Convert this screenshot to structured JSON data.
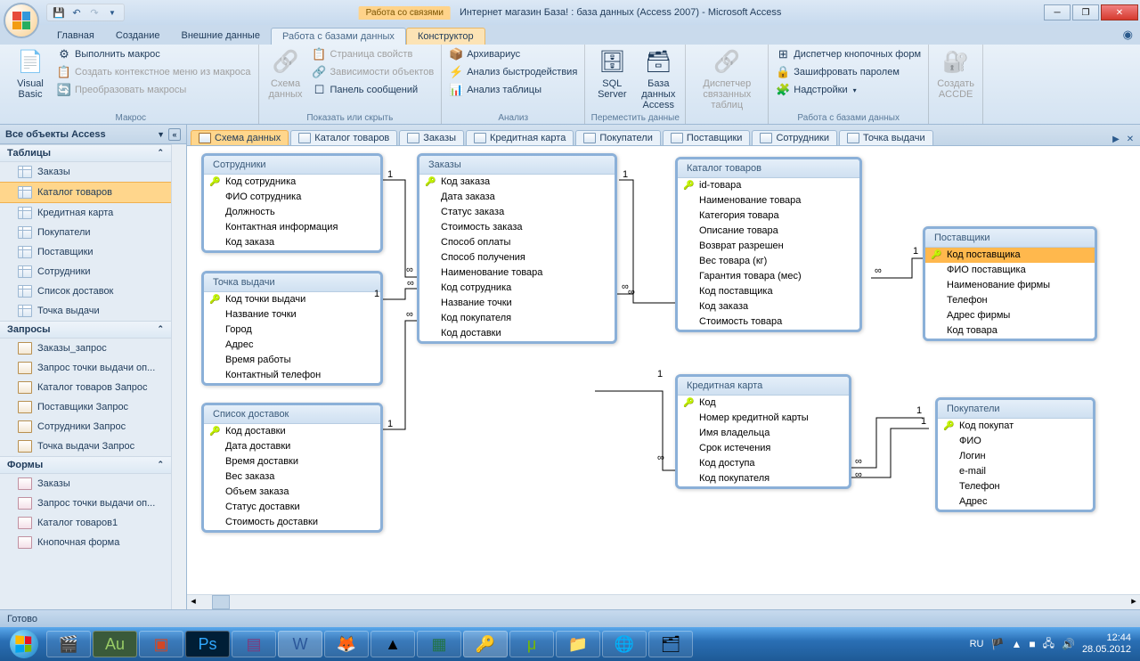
{
  "titlebar": {
    "context": "Работа со связями",
    "title": "Интернет магазин База! : база данных (Access 2007) - Microsoft Access"
  },
  "ribbon_tabs": [
    "Главная",
    "Создание",
    "Внешние данные",
    "Работа с базами данных",
    "Конструктор"
  ],
  "ribbon_tabs_active_index": 3,
  "ribbon": {
    "g1": {
      "label": "Макрос",
      "big": "Visual\nBasic",
      "items": [
        "Выполнить макрос",
        "Создать контекстное меню из макроса",
        "Преобразовать макросы"
      ]
    },
    "g2": {
      "label": "Показать или скрыть",
      "big": "Схема\nданных",
      "items": [
        "Страница свойств",
        "Зависимости объектов",
        "Панель сообщений"
      ]
    },
    "g3": {
      "label": "Анализ",
      "items": [
        "Архивариус",
        "Анализ быстродействия",
        "Анализ таблицы"
      ]
    },
    "g4": {
      "label": "Переместить данные",
      "b1": "SQL\nServer",
      "b2": "База данных\nAccess"
    },
    "g5": {
      "big": "Диспетчер\nсвязанных таблиц"
    },
    "g6": {
      "label": "Работа с базами данных",
      "items": [
        "Диспетчер кнопочных форм",
        "Зашифровать паролем",
        "Надстройки"
      ]
    },
    "g7": {
      "big": "Создать\nACCDE"
    }
  },
  "nav": {
    "header": "Все объекты Access",
    "g_tables": "Таблицы",
    "tables": [
      "Заказы",
      "Каталог товаров",
      "Кредитная карта",
      "Покупатели",
      "Поставщики",
      "Сотрудники",
      "Список доставок",
      "Точка выдачи"
    ],
    "tables_selected_index": 1,
    "g_queries": "Запросы",
    "queries": [
      "Заказы_запрос",
      "Запрос точки выдачи оп...",
      "Каталог товаров Запрос",
      "Поставщики Запрос",
      "Сотрудники Запрос",
      "Точка выдачи Запрос"
    ],
    "g_forms": "Формы",
    "forms": [
      "Заказы",
      "Запрос точки выдачи оп...",
      "Каталог товаров1",
      "Кнопочная форма"
    ]
  },
  "doc_tabs": [
    "Схема данных",
    "Каталог товаров",
    "Заказы",
    "Кредитная карта",
    "Покупатели",
    "Поставщики",
    "Сотрудники",
    "Точка выдачи"
  ],
  "doc_tabs_active_index": 0,
  "schema": {
    "t1": {
      "title": "Сотрудники",
      "rows": [
        "Код сотрудника",
        "ФИО сотрудника",
        "Должность",
        "Контактная информация",
        "Код заказа"
      ],
      "pk": [
        0
      ]
    },
    "t2": {
      "title": "Точка выдачи",
      "rows": [
        "Код точки выдачи",
        "Название точки",
        "Город",
        "Адрес",
        "Время работы",
        "Контактный телефон"
      ],
      "pk": [
        0
      ]
    },
    "t3": {
      "title": "Список доставок",
      "rows": [
        "Код доставки",
        "Дата доставки",
        "Время доставки",
        "Вес заказа",
        "Объем заказа",
        "Статус доставки",
        "Стоимость доставки"
      ],
      "pk": [
        0
      ]
    },
    "t4": {
      "title": "Заказы",
      "rows": [
        "Код заказа",
        "Дата заказа",
        "Статус заказа",
        "Стоимость заказа",
        "Способ оплаты",
        "Способ получения",
        "Наименование товара",
        "Код сотрудника",
        "Название точки",
        "Код покупателя",
        "Код доставки"
      ],
      "pk": [
        0
      ]
    },
    "t5": {
      "title": "Каталог товаров",
      "rows": [
        "id-товара",
        "Наименование товара",
        "Категория товара",
        "Описание товара",
        "Возврат разрешен",
        "Вес товара (кг)",
        "Гарантия товара (мес)",
        "Код поставщика",
        "Код заказа",
        "Стоимость товара"
      ],
      "pk": [
        0
      ]
    },
    "t6": {
      "title": "Кредитная карта",
      "rows": [
        "Код",
        "Номер кредитной карты",
        "Имя владельца",
        "Срок истечения",
        "Код доступа",
        "Код покупателя"
      ],
      "pk": [
        0
      ]
    },
    "t7": {
      "title": "Поставщики",
      "rows": [
        "Код поставщика",
        "ФИО поставщика",
        "Наименование фирмы",
        "Телефон",
        "Адрес фирмы",
        "Код товара"
      ],
      "pk": [
        0
      ],
      "selected": 0
    },
    "t8": {
      "title": "Покупатели",
      "rows": [
        "Код покупат",
        "ФИО",
        "Логин",
        "e-mail",
        "Телефон",
        "Адрес"
      ],
      "pk": [
        0
      ]
    }
  },
  "statusbar": "Готово",
  "tray": {
    "lang": "RU",
    "time": "12:44",
    "date": "28.05.2012"
  }
}
